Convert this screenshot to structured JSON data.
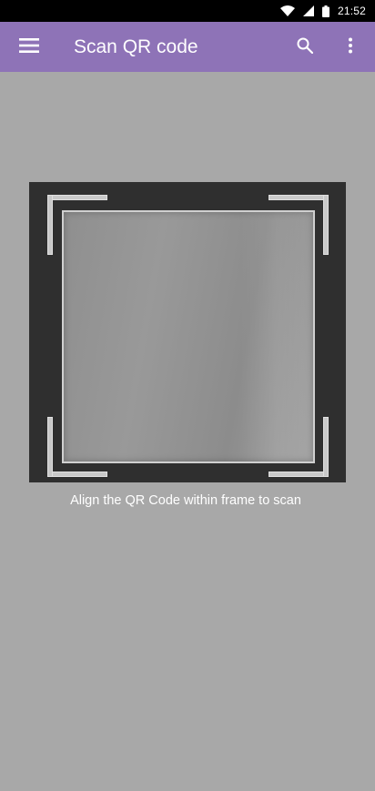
{
  "status_bar": {
    "time": "21:52",
    "icons": [
      "wifi-icon",
      "signal-icon",
      "battery-icon"
    ]
  },
  "app_bar": {
    "title": "Scan QR code",
    "background_color": "#8e73b7",
    "left_icon": "menu-icon",
    "right_icons": [
      "search-icon",
      "more-vert-icon"
    ]
  },
  "scanner": {
    "instruction": "Align the QR Code within frame to scan"
  }
}
